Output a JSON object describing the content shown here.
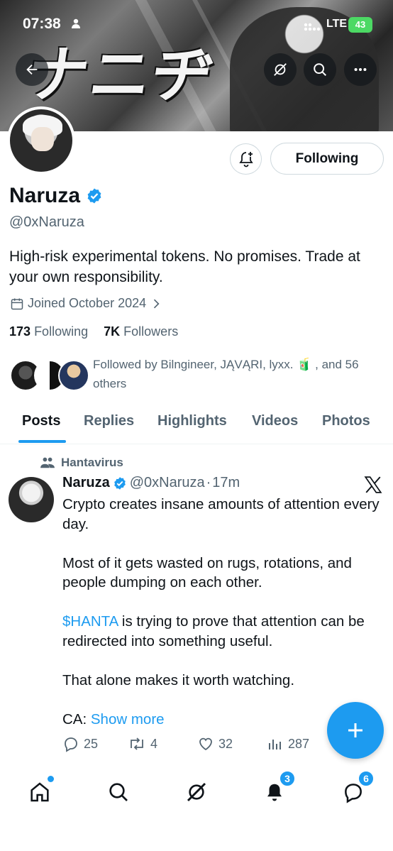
{
  "status_bar": {
    "time": "07:38",
    "network": "LTE",
    "battery": "43"
  },
  "banner": {
    "text": "ナニヂ"
  },
  "profile": {
    "name": "Naruza",
    "handle": "@0xNaruza",
    "bio": "High-risk experimental tokens. No promises. Trade at your own responsibility.",
    "joined": "Joined October 2024",
    "following_count": "173",
    "following_label": "Following",
    "followers_count": "7K",
    "followers_label": "Followers",
    "followed_by": "Followed by Bilngineer, JĄVĄRI, lyxx. 🧃 , and 56 others",
    "follow_button": "Following"
  },
  "tabs": [
    "Posts",
    "Replies",
    "Highlights",
    "Videos",
    "Photos"
  ],
  "tweet": {
    "community": "Hantavirus",
    "name": "Naruza",
    "handle": "@0xNaruza",
    "time": "17m",
    "line1": "Crypto creates insane amounts of attention every day.",
    "line2": "Most of it gets wasted on rugs, rotations, and people dumping on each other.",
    "cashtag": "$HANTA",
    "line3_rest": " is trying to prove that attention can be redirected into something useful.",
    "line4": "That alone makes it worth watching.",
    "ca_label": "CA: ",
    "show_more": "Show more",
    "replies": "25",
    "reposts": "4",
    "likes": "32",
    "views": "287"
  },
  "nav": {
    "notifications_badge": "3",
    "messages_badge": "6"
  },
  "colors": {
    "accent": "#1d9bf0",
    "text": "#0f1419",
    "muted": "#536471"
  }
}
